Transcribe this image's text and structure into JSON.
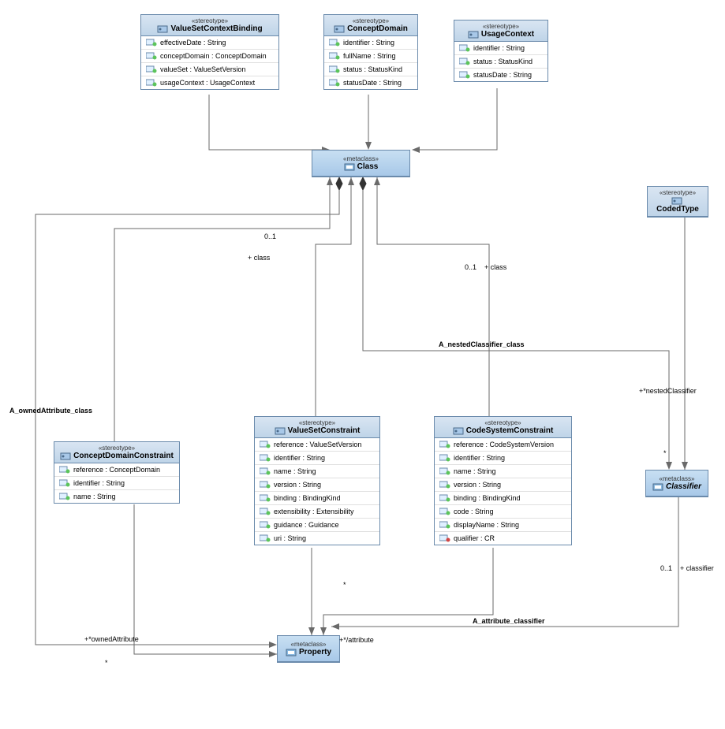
{
  "boxes": {
    "valueSetContextBinding": {
      "stereotype": "«stereotype»",
      "name": "ValueSetContextBinding",
      "attrs": [
        "effectiveDate : String",
        "conceptDomain : ConceptDomain",
        "valueSet : ValueSetVersion",
        "usageContext : UsageContext"
      ]
    },
    "conceptDomain": {
      "stereotype": "«stereotype»",
      "name": "ConceptDomain",
      "attrs": [
        "identifier : String",
        "fullName : String",
        "status : StatusKind",
        "statusDate : String"
      ]
    },
    "usageContext": {
      "stereotype": "«stereotype»",
      "name": "UsageContext",
      "attrs": [
        "identifier : String",
        "status : StatusKind",
        "statusDate : String"
      ]
    },
    "class": {
      "stereotype": "«metaclass»",
      "name": "Class"
    },
    "codedType": {
      "stereotype": "«stereotype»",
      "name": "CodedType"
    },
    "conceptDomainConstraint": {
      "stereotype": "«stereotype»",
      "name": "ConceptDomainConstraint",
      "attrs": [
        "reference : ConceptDomain",
        "identifier : String",
        "name : String"
      ]
    },
    "valueSetConstraint": {
      "stereotype": "«stereotype»",
      "name": "ValueSetConstraint",
      "attrs": [
        "reference : ValueSetVersion",
        "identifier : String",
        "name : String",
        "version : String",
        "binding : BindingKind",
        "extensibility : Extensibility",
        "guidance : Guidance",
        "uri : String"
      ]
    },
    "codeSystemConstraint": {
      "stereotype": "«stereotype»",
      "name": "CodeSystemConstraint",
      "attrs": [
        "reference : CodeSystemVersion",
        "identifier : String",
        "name : String",
        "version : String",
        "binding : BindingKind",
        "code : String",
        "displayName : String",
        "qualifier : CR"
      ]
    },
    "classifier": {
      "stereotype": "«metaclass»",
      "name": "Classifier"
    },
    "property": {
      "stereotype": "«metaclass»",
      "name": "Property"
    }
  },
  "labels": {
    "zeroOne1": "0..1",
    "plusClass1": "+ class",
    "zeroOne2": "0..1",
    "plusClass2": "+ class",
    "aNestedClassifier": "A_nestedClassifier_class",
    "plusNestedClassifier": "+*nestedClassifier",
    "aOwnedAttribute": "A_ownedAttribute_class",
    "zeroOne3": "0..1",
    "plusClassifier": "+ classifier",
    "star1": "*",
    "aAttributeClassifier": "A_attribute_classifier",
    "plusOwnedAttribute": "+*ownedAttribute",
    "star2": "*",
    "plusAttribute": "+*/attribute",
    "star3": "*"
  },
  "chart_data": {
    "type": "uml-class-diagram",
    "classes": [
      {
        "name": "ValueSetContextBinding",
        "kind": "stereotype",
        "attributes": [
          "effectiveDate : String",
          "conceptDomain : ConceptDomain",
          "valueSet : ValueSetVersion",
          "usageContext : UsageContext"
        ]
      },
      {
        "name": "ConceptDomain",
        "kind": "stereotype",
        "attributes": [
          "identifier : String",
          "fullName : String",
          "status : StatusKind",
          "statusDate : String"
        ]
      },
      {
        "name": "UsageContext",
        "kind": "stereotype",
        "attributes": [
          "identifier : String",
          "status : StatusKind",
          "statusDate : String"
        ]
      },
      {
        "name": "Class",
        "kind": "metaclass"
      },
      {
        "name": "CodedType",
        "kind": "stereotype"
      },
      {
        "name": "ConceptDomainConstraint",
        "kind": "stereotype",
        "attributes": [
          "reference : ConceptDomain",
          "identifier : String",
          "name : String"
        ]
      },
      {
        "name": "ValueSetConstraint",
        "kind": "stereotype",
        "attributes": [
          "reference : ValueSetVersion",
          "identifier : String",
          "name : String",
          "version : String",
          "binding : BindingKind",
          "extensibility : Extensibility",
          "guidance : Guidance",
          "uri : String"
        ]
      },
      {
        "name": "CodeSystemConstraint",
        "kind": "stereotype",
        "attributes": [
          "reference : CodeSystemVersion",
          "identifier : String",
          "name : String",
          "version : String",
          "binding : BindingKind",
          "code : String",
          "displayName : String",
          "qualifier : CR"
        ]
      },
      {
        "name": "Classifier",
        "kind": "metaclass"
      },
      {
        "name": "Property",
        "kind": "metaclass"
      }
    ],
    "relationships": [
      {
        "from": "ValueSetContextBinding",
        "to": "Class",
        "type": "extension"
      },
      {
        "from": "ConceptDomain",
        "to": "Class",
        "type": "extension"
      },
      {
        "from": "UsageContext",
        "to": "Class",
        "type": "extension"
      },
      {
        "from": "CodedType",
        "to": "Classifier",
        "type": "extension"
      },
      {
        "from": "ConceptDomainConstraint",
        "to": "Class",
        "type": "extension"
      },
      {
        "from": "ValueSetConstraint",
        "to": "Class",
        "type": "extension"
      },
      {
        "from": "CodeSystemConstraint",
        "to": "Class",
        "type": "extension"
      },
      {
        "from": "Class",
        "to": "Property",
        "type": "composition",
        "name": "A_ownedAttribute_class",
        "end1": "+ class 0..1",
        "end2": "+ ownedAttribute *"
      },
      {
        "from": "Class",
        "to": "Classifier",
        "type": "composition",
        "name": "A_nestedClassifier_class",
        "end1": "+ class 0..1",
        "end2": "+ nestedClassifier *"
      },
      {
        "from": "Classifier",
        "to": "Property",
        "type": "association",
        "name": "A_attribute_classifier",
        "end1": "+ classifier 0..1",
        "end2": "+ /attribute *"
      },
      {
        "from": "ConceptDomainConstraint",
        "to": "Property",
        "type": "extension"
      },
      {
        "from": "ValueSetConstraint",
        "to": "Property",
        "type": "extension"
      },
      {
        "from": "CodeSystemConstraint",
        "to": "Property",
        "type": "extension"
      }
    ]
  }
}
